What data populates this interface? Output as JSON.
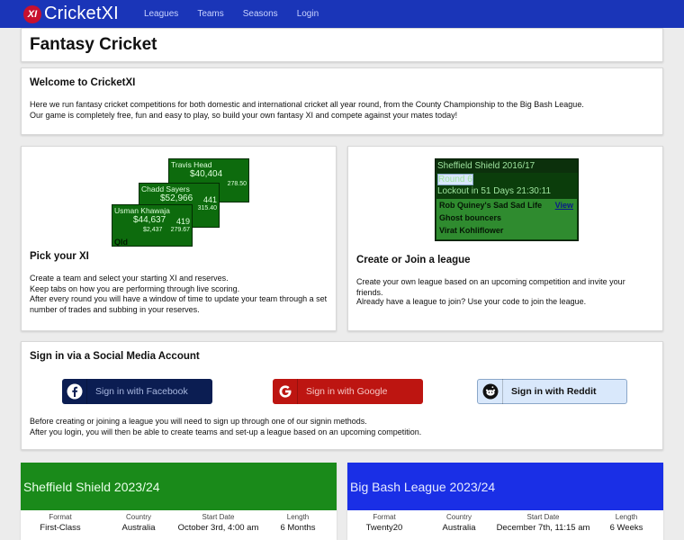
{
  "navbar": {
    "brand_logo_text": "XI",
    "brand_name": "CricketXI",
    "links": [
      "Leagues",
      "Teams",
      "Seasons",
      "Login"
    ]
  },
  "page_title": "Fantasy Cricket",
  "welcome": {
    "title": "Welcome to CricketXI",
    "line1": "Here we run fantasy cricket competitions for both domestic and international cricket all year round, from the County Championship to the Big Bash League.",
    "line2": "Our game is completely free, fun and easy to play, so build your own fantasy XI and compete against your mates today!"
  },
  "pick": {
    "title": "Pick your XI",
    "players": [
      {
        "name": "Travis Head",
        "value": "$40,404",
        "s1": "",
        "s2": "278.50"
      },
      {
        "name": "Chadd Sayers",
        "value": "$52,966",
        "s1": "441",
        "s2": "315.40"
      },
      {
        "name": "Usman Khawaja",
        "value": "$44,637",
        "s1": "419",
        "s3": "$2,437",
        "s2": "279.67"
      }
    ],
    "footer_label": "Qld",
    "lines": [
      "Create a team and select your starting XI and reserves.",
      "Keep tabs on how you are performing through live scoring.",
      "After every round you will have a window of time to update your team through a set number of trades and subbing in your reserves."
    ]
  },
  "create": {
    "title": "Create or Join a league",
    "mini": {
      "header": "Sheffield Shield 2016/17",
      "round": "Round 6",
      "lockout": "Lockout in 51 Days 21:30:11",
      "rows": [
        "Rob Quiney's Sad Sad Life",
        "Ghost bouncers",
        "Virat Kohliflower"
      ],
      "view": "View"
    },
    "lines": [
      "Create your own league based on an upcoming competition and invite your friends.",
      "Already have a league to join? Use your code to join the league."
    ]
  },
  "signin": {
    "title": "Sign in via a Social Media Account",
    "facebook": "Sign in with Facebook",
    "google": "Sign in with Google",
    "reddit": "Sign in with Reddit",
    "line1": "Before creating or joining a league you will need to sign up through one of our signin methods.",
    "line2": "After you login, you will then be able to create teams and set-up a league based on an upcoming competition."
  },
  "competitions": [
    {
      "title": "Sheffield Shield 2023/24",
      "color": "#1a8a1a",
      "format_label": "Format",
      "format": "First-Class",
      "country_label": "Country",
      "country": "Australia",
      "start_label": "Start Date",
      "start": "October 3rd, 4:00 am",
      "length_label": "Length",
      "length": "6 Months"
    },
    {
      "title": "Big Bash League 2023/24",
      "color": "#1a2fe6",
      "format_label": "Format",
      "format": "Twenty20",
      "country_label": "Country",
      "country": "Australia",
      "start_label": "Start Date",
      "start": "December 7th, 11:15 am",
      "length_label": "Length",
      "length": "6 Weeks"
    }
  ]
}
